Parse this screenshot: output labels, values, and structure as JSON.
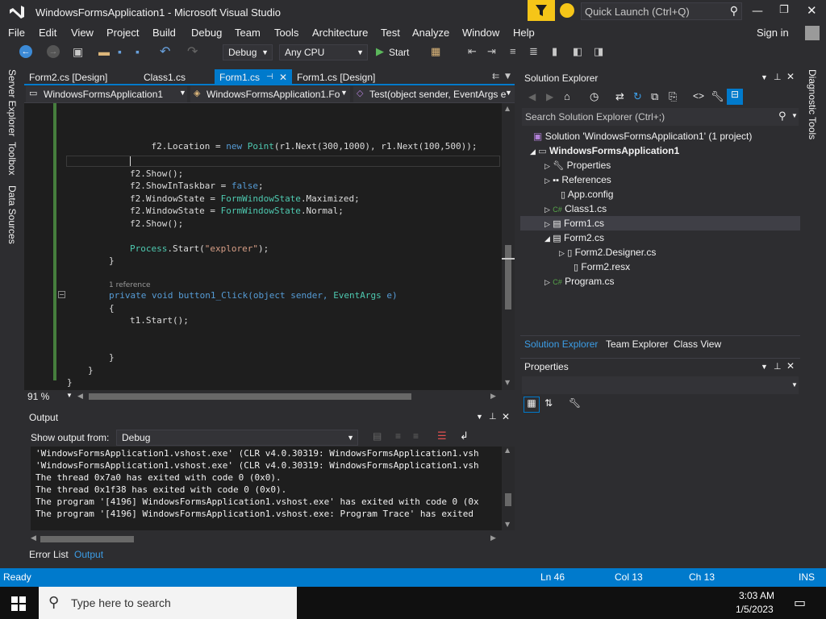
{
  "window": {
    "title": "WindowsFormsApplication1 - Microsoft Visual Studio",
    "quick_launch_placeholder": "Quick Launch (Ctrl+Q)"
  },
  "menu": [
    "File",
    "Edit",
    "View",
    "Project",
    "Build",
    "Debug",
    "Team",
    "Tools",
    "Architecture",
    "Test",
    "Analyze",
    "Window",
    "Help"
  ],
  "signin": "Sign in",
  "toolbar": {
    "config": "Debug",
    "platform": "Any CPU",
    "start": "Start"
  },
  "tabs": [
    {
      "label": "Form2.cs [Design]"
    },
    {
      "label": "Class1.cs"
    },
    {
      "label": "Form1.cs",
      "active": true
    },
    {
      "label": "Form1.cs [Design]"
    }
  ],
  "navbar": {
    "project": "WindowsFormsApplication1",
    "class": "WindowsFormsApplication1.Fo",
    "member": "Test(object sender, EventArgs e"
  },
  "side_tabs": [
    "Server Explorer",
    "Toolbox",
    "Data Sources"
  ],
  "right_tab": "Diagnostic Tools",
  "code_lines": [
    {
      "t": "f2.Location = new Point(r1.Next(300,1000), r1.Next(100,500));"
    },
    {
      "t": "f2.Show();"
    },
    {
      "t": "f2.ShowInTaskbar = false;"
    },
    {
      "t": "f2.WindowState = FormWindowState.Maximized;"
    },
    {
      "t": "f2.WindowState = FormWindowState.Normal;"
    },
    {
      "t": "f2.Show();"
    },
    {
      "t": "Process.Start(\"explorer\");"
    },
    {
      "t": "}"
    },
    {
      "t": "1 reference"
    },
    {
      "t": "private void button1_Click(object sender, EventArgs e)"
    },
    {
      "t": "{"
    },
    {
      "t": "t1.Start();"
    },
    {
      "t": "}"
    },
    {
      "t": "}"
    },
    {
      "t": "}"
    }
  ],
  "zoom": "91 %",
  "output": {
    "title": "Output",
    "show_from_label": "Show output from:",
    "show_from_value": "Debug",
    "lines": [
      "'WindowsFormsApplication1.vshost.exe' (CLR v4.0.30319: WindowsFormsApplication1.vsh",
      "'WindowsFormsApplication1.vshost.exe' (CLR v4.0.30319: WindowsFormsApplication1.vsh",
      "The thread 0x7a0 has exited with code 0 (0x0).",
      "The thread 0x1f38 has exited with code 0 (0x0).",
      "The program '[4196] WindowsFormsApplication1.vshost.exe' has exited with code 0 (0x",
      "The program '[4196] WindowsFormsApplication1.vshost.exe: Program Trace' has exited"
    ],
    "bottom_tabs": [
      "Error List",
      "Output"
    ]
  },
  "solution_explorer": {
    "title": "Solution Explorer",
    "search_placeholder": "Search Solution Explorer (Ctrl+;)",
    "items": [
      "Solution 'WindowsFormsApplication1' (1 project)",
      "WindowsFormsApplication1",
      "Properties",
      "References",
      "App.config",
      "Class1.cs",
      "Form1.cs",
      "Form2.cs",
      "Form2.Designer.cs",
      "Form2.resx",
      "Program.cs"
    ],
    "bottom_tabs": [
      "Solution Explorer",
      "Team Explorer",
      "Class View"
    ]
  },
  "properties": {
    "title": "Properties"
  },
  "status": {
    "ready": "Ready",
    "ln": "Ln 46",
    "col": "Col 13",
    "ch": "Ch 13",
    "ins": "INS"
  },
  "taskbar": {
    "search_placeholder": "Type here to search",
    "time": "3:03 AM",
    "date": "1/5/2023"
  },
  "colors": {
    "accent": "#007acc",
    "bg": "#2d2d30",
    "editor": "#1e1e1e",
    "status": "#007acc",
    "taskbar": "#101010"
  }
}
